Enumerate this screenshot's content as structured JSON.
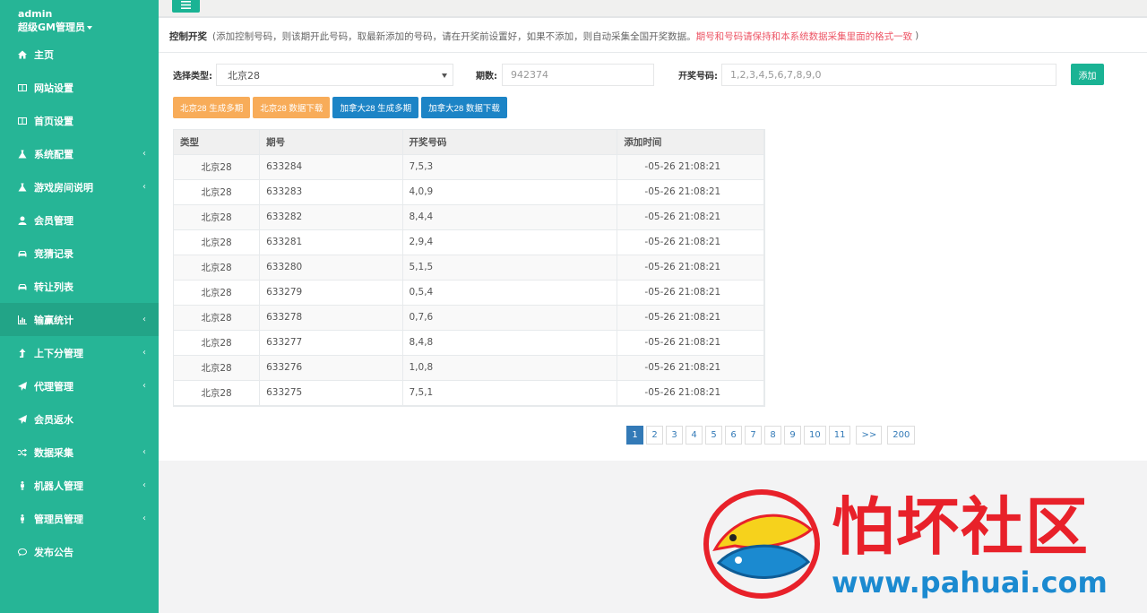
{
  "user": {
    "top_text": "",
    "name": "admin",
    "role": "超级GM管理员"
  },
  "sidebar": {
    "items": [
      {
        "label": "主页",
        "icon": "home-icon",
        "chevron": false
      },
      {
        "label": "网站设置",
        "icon": "columns-icon",
        "chevron": false
      },
      {
        "label": "首页设置",
        "icon": "columns-icon",
        "chevron": false
      },
      {
        "label": "系统配置",
        "icon": "flask-icon",
        "chevron": true
      },
      {
        "label": "游戏房间说明",
        "icon": "flask-icon",
        "chevron": true
      },
      {
        "label": "会员管理",
        "icon": "user-icon",
        "chevron": false
      },
      {
        "label": "竞猜记录",
        "icon": "car-icon",
        "chevron": false
      },
      {
        "label": "转让列表",
        "icon": "car-icon",
        "chevron": false
      },
      {
        "label": "输赢统计",
        "icon": "chart-icon",
        "chevron": true
      },
      {
        "label": "上下分管理",
        "icon": "level-up-icon",
        "chevron": true
      },
      {
        "label": "代理管理",
        "icon": "paper-plane-icon",
        "chevron": true
      },
      {
        "label": "会员返水",
        "icon": "paper-plane-icon",
        "chevron": false
      },
      {
        "label": "数据采集",
        "icon": "random-icon",
        "chevron": true
      },
      {
        "label": "机器人管理",
        "icon": "male-icon",
        "chevron": true
      },
      {
        "label": "管理员管理",
        "icon": "male-icon",
        "chevron": true
      },
      {
        "label": "发布公告",
        "icon": "comment-icon",
        "chevron": false
      }
    ],
    "chevron_glyph": "‹"
  },
  "header": {
    "title": "控制开奖",
    "note": "(添加控制号码，则该期开此号码，取最新添加的号码，请在开奖前设置好，如果不添加，则自动采集全国开奖数据。",
    "warning": "期号和号码请保持和本系统数据采集里面的格式一致",
    "close_paren": ")"
  },
  "form": {
    "type_label": "选择类型:",
    "type_value": "北京28",
    "issue_label": "期数:",
    "issue_placeholder": "942374",
    "numbers_label": "开奖号码:",
    "numbers_placeholder": "1,2,3,4,5,6,7,8,9,0",
    "add_label": "添加"
  },
  "actions": {
    "bj_generate": "北京28 生成多期",
    "bj_download": "北京28 数据下载",
    "ca_generate": "加拿大28 生成多期",
    "ca_download": "加拿大28 数据下载"
  },
  "table": {
    "headers": [
      "类型",
      "期号",
      "开奖号码",
      "添加时间"
    ],
    "rows": [
      [
        "北京28",
        "633284",
        "7,5,3",
        "-05-26 21:08:21"
      ],
      [
        "北京28",
        "633283",
        "4,0,9",
        "-05-26 21:08:21"
      ],
      [
        "北京28",
        "633282",
        "8,4,4",
        "-05-26 21:08:21"
      ],
      [
        "北京28",
        "633281",
        "2,9,4",
        "-05-26 21:08:21"
      ],
      [
        "北京28",
        "633280",
        "5,1,5",
        "-05-26 21:08:21"
      ],
      [
        "北京28",
        "633279",
        "0,5,4",
        "-05-26 21:08:21"
      ],
      [
        "北京28",
        "633278",
        "0,7,6",
        "-05-26 21:08:21"
      ],
      [
        "北京28",
        "633277",
        "8,4,8",
        "-05-26 21:08:21"
      ],
      [
        "北京28",
        "633276",
        "1,0,8",
        "-05-26 21:08:21"
      ],
      [
        "北京28",
        "633275",
        "7,5,1",
        "-05-26 21:08:21"
      ]
    ]
  },
  "pagination": {
    "pages": [
      "1",
      "2",
      "3",
      "4",
      "5",
      "6",
      "7",
      "8",
      "9",
      "10",
      "11"
    ],
    "current": "1",
    "next": ">>",
    "last": "200"
  },
  "watermark": {
    "title": "怕坏社区",
    "url": "www.pahuai.com"
  },
  "colors": {
    "sidebar": "#26b596",
    "primary": "#1ab394",
    "orange": "#f8ac59",
    "blue": "#1c84c6",
    "warning": "#ed5565",
    "pager_active": "#337ab7"
  }
}
